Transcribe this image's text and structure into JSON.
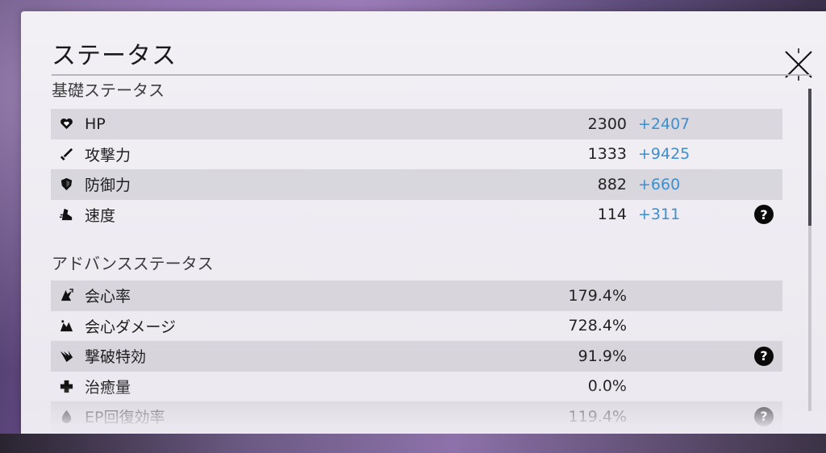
{
  "title": "ステータス",
  "basic_section": {
    "title": "基礎ステータス",
    "rows": [
      {
        "icon": "heart-icon",
        "label": "HP",
        "base": "2300",
        "bonus": "+2407",
        "help": false
      },
      {
        "icon": "sword-icon",
        "label": "攻撃力",
        "base": "1333",
        "bonus": "+9425",
        "help": false
      },
      {
        "icon": "shield-icon",
        "label": "防御力",
        "base": "882",
        "bonus": "+660",
        "help": false
      },
      {
        "icon": "boot-icon",
        "label": "速度",
        "base": "114",
        "bonus": "+311",
        "help": true
      }
    ]
  },
  "advanced_section": {
    "title": "アドバンスステータス",
    "rows": [
      {
        "icon": "crit-rate-icon",
        "label": "会心率",
        "base": "179.4%",
        "help": false
      },
      {
        "icon": "crit-damage-icon",
        "label": "会心ダメージ",
        "base": "728.4%",
        "help": false
      },
      {
        "icon": "break-effect-icon",
        "label": "撃破特効",
        "base": "91.9%",
        "help": true
      },
      {
        "icon": "healing-icon",
        "label": "治癒量",
        "base": "0.0%",
        "help": false
      },
      {
        "icon": "energy-regen-icon",
        "label": "EP回復効率",
        "base": "119.4%",
        "help": true
      }
    ]
  },
  "help_symbol": "?",
  "colors": {
    "bonus": "#3c8fd0",
    "row_shade": "#d6d4da",
    "panel": "#efedf2"
  }
}
